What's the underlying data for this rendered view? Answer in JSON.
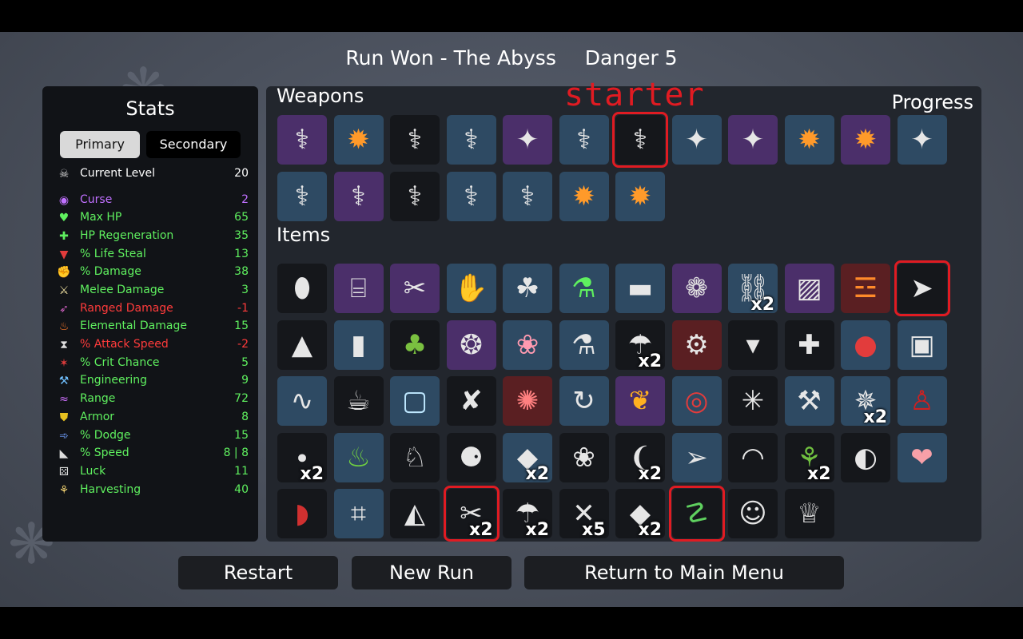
{
  "header": {
    "title": "Run Won - The Abyss",
    "danger": "Danger 5"
  },
  "stats": {
    "title": "Stats",
    "tabs": {
      "primary": "Primary",
      "secondary": "Secondary"
    },
    "rows": [
      {
        "icon": "skull-icon",
        "label": "Current Level",
        "value": "20",
        "label_color": "#ffffff",
        "value_color": "#ffffff"
      },
      {
        "icon": "eye-icon",
        "label": "Curse",
        "value": "2",
        "label_color": "#c070ff",
        "value_color": "#c070ff"
      },
      {
        "icon": "heart-icon",
        "label": "Max HP",
        "value": "65",
        "label_color": "#5ff05f",
        "value_color": "#5ff05f"
      },
      {
        "icon": "heart-plus-icon",
        "label": "HP Regeneration",
        "value": "35",
        "label_color": "#5ff05f",
        "value_color": "#5ff05f"
      },
      {
        "icon": "fang-icon",
        "label": "% Life Steal",
        "value": "13",
        "label_color": "#5ff05f",
        "value_color": "#5ff05f"
      },
      {
        "icon": "fist-icon",
        "label": "% Damage",
        "value": "38",
        "label_color": "#5ff05f",
        "value_color": "#5ff05f"
      },
      {
        "icon": "sword-icon",
        "label": "Melee Damage",
        "value": "3",
        "label_color": "#5ff05f",
        "value_color": "#5ff05f"
      },
      {
        "icon": "bow-icon",
        "label": "Ranged Damage",
        "value": "-1",
        "label_color": "#ff3b3b",
        "value_color": "#ff3b3b"
      },
      {
        "icon": "flame-icon",
        "label": "Elemental Damage",
        "value": "15",
        "label_color": "#5ff05f",
        "value_color": "#5ff05f"
      },
      {
        "icon": "hourglass-icon",
        "label": "% Attack Speed",
        "value": "-2",
        "label_color": "#ff3b3b",
        "value_color": "#ff3b3b"
      },
      {
        "icon": "crit-icon",
        "label": "% Crit Chance",
        "value": "5",
        "label_color": "#5ff05f",
        "value_color": "#5ff05f"
      },
      {
        "icon": "wrench-icon",
        "label": "Engineering",
        "value": "9",
        "label_color": "#5ff05f",
        "value_color": "#5ff05f"
      },
      {
        "icon": "range-icon",
        "label": "Range",
        "value": "72",
        "label_color": "#5ff05f",
        "value_color": "#5ff05f"
      },
      {
        "icon": "shield-icon",
        "label": "Armor",
        "value": "8",
        "label_color": "#5ff05f",
        "value_color": "#5ff05f"
      },
      {
        "icon": "dodge-icon",
        "label": "% Dodge",
        "value": "15",
        "label_color": "#5ff05f",
        "value_color": "#5ff05f"
      },
      {
        "icon": "boot-icon",
        "label": "% Speed",
        "value": "8 | 8",
        "label_color": "#5ff05f",
        "value_color": "#5ff05f"
      },
      {
        "icon": "dice-icon",
        "label": "Luck",
        "value": "11",
        "label_color": "#5ff05f",
        "value_color": "#5ff05f"
      },
      {
        "icon": "wheat-icon",
        "label": "Harvesting",
        "value": "40",
        "label_color": "#5ff05f",
        "value_color": "#5ff05f"
      }
    ]
  },
  "weapons": {
    "title": "Weapons",
    "starter_label": "starter",
    "progress_label": "Progress",
    "slots": [
      {
        "icon": "spoon-icon",
        "rarity": "purple"
      },
      {
        "icon": "fireball-icon",
        "rarity": "blue"
      },
      {
        "icon": "spoon-icon",
        "rarity": "black"
      },
      {
        "icon": "spoon-icon",
        "rarity": "blue"
      },
      {
        "icon": "wand-icon",
        "rarity": "purple"
      },
      {
        "icon": "spoon-icon",
        "rarity": "blue"
      },
      {
        "icon": "spoon-icon",
        "rarity": "black",
        "highlight": true
      },
      {
        "icon": "wand-icon",
        "rarity": "blue"
      },
      {
        "icon": "wand-icon",
        "rarity": "purple"
      },
      {
        "icon": "fireball-icon",
        "rarity": "blue"
      },
      {
        "icon": "fireball-icon",
        "rarity": "purple"
      },
      {
        "icon": "wand-icon",
        "rarity": "blue"
      },
      {
        "icon": "spoon-icon",
        "rarity": "blue"
      },
      {
        "icon": "spoon-icon",
        "rarity": "purple"
      },
      {
        "icon": "spoon-icon",
        "rarity": "black"
      },
      {
        "icon": "spoon-icon",
        "rarity": "blue"
      },
      {
        "icon": "spoon-icon",
        "rarity": "blue"
      },
      {
        "icon": "fireball-icon",
        "rarity": "blue"
      },
      {
        "icon": "fireball-icon",
        "rarity": "blue"
      }
    ]
  },
  "items": {
    "title": "Items",
    "slots": [
      {
        "icon": "egg-icon",
        "rarity": "black"
      },
      {
        "icon": "bottle-icon",
        "rarity": "purple"
      },
      {
        "icon": "pliers-icon",
        "rarity": "purple"
      },
      {
        "icon": "claw-glove-icon",
        "rarity": "blue"
      },
      {
        "icon": "garden-icon",
        "rarity": "blue"
      },
      {
        "icon": "potion-icon",
        "rarity": "blue"
      },
      {
        "icon": "rock-icon",
        "rarity": "blue"
      },
      {
        "icon": "tardigrade-icon",
        "rarity": "purple"
      },
      {
        "icon": "chain-icon",
        "rarity": "blue",
        "count": "x2"
      },
      {
        "icon": "mirror-icon",
        "rarity": "purple"
      },
      {
        "icon": "torch-icon",
        "rarity": "red"
      },
      {
        "icon": "drill-icon",
        "rarity": "black",
        "highlight": true
      },
      {
        "icon": "sack-icon",
        "rarity": "black"
      },
      {
        "icon": "stone-tablet-icon",
        "rarity": "blue"
      },
      {
        "icon": "tree-icon",
        "rarity": "black"
      },
      {
        "icon": "drone-icon",
        "rarity": "purple"
      },
      {
        "icon": "squid-icon",
        "rarity": "blue"
      },
      {
        "icon": "flask-icon",
        "rarity": "blue"
      },
      {
        "icon": "mushroom-icon",
        "rarity": "black",
        "count": "x2"
      },
      {
        "icon": "mech-icon",
        "rarity": "red"
      },
      {
        "icon": "tooth-icon",
        "rarity": "black"
      },
      {
        "icon": "medic-bot-icon",
        "rarity": "black"
      },
      {
        "icon": "tomato-icon",
        "rarity": "blue"
      },
      {
        "icon": "armor-plate-icon",
        "rarity": "blue"
      },
      {
        "icon": "worm-icon",
        "rarity": "blue"
      },
      {
        "icon": "tea-cup-icon",
        "rarity": "black"
      },
      {
        "icon": "ice-cube-icon",
        "rarity": "blue"
      },
      {
        "icon": "fish-head-icon",
        "rarity": "black"
      },
      {
        "icon": "octopus-icon",
        "rarity": "red"
      },
      {
        "icon": "tentacle-icon",
        "rarity": "blue"
      },
      {
        "icon": "goldfish-icon",
        "rarity": "purple"
      },
      {
        "icon": "lifebuoy-icon",
        "rarity": "blue"
      },
      {
        "icon": "hedgehog-icon",
        "rarity": "black"
      },
      {
        "icon": "wrench-arm-icon",
        "rarity": "blue"
      },
      {
        "icon": "wasp-icon",
        "rarity": "blue",
        "count": "x2"
      },
      {
        "icon": "ketchup-icon",
        "rarity": "blue"
      },
      {
        "icon": "pebbles-icon",
        "rarity": "black",
        "count": "x2"
      },
      {
        "icon": "cauldron-icon",
        "rarity": "blue"
      },
      {
        "icon": "dog-icon",
        "rarity": "black"
      },
      {
        "icon": "bat-icon",
        "rarity": "black"
      },
      {
        "icon": "grenade-icon",
        "rarity": "blue",
        "count": "x2"
      },
      {
        "icon": "spore-bag-icon",
        "rarity": "black"
      },
      {
        "icon": "leech-icon",
        "rarity": "black",
        "count": "x2"
      },
      {
        "icon": "missile-icon",
        "rarity": "blue"
      },
      {
        "icon": "beanie-icon",
        "rarity": "black"
      },
      {
        "icon": "sprout-icon",
        "rarity": "black",
        "count": "x2"
      },
      {
        "icon": "fang-mouth-icon",
        "rarity": "black"
      },
      {
        "icon": "piggy-bank-icon",
        "rarity": "blue"
      },
      {
        "icon": "whistle-icon",
        "rarity": "black"
      },
      {
        "icon": "cash-register-icon",
        "rarity": "blue"
      },
      {
        "icon": "cake-icon",
        "rarity": "black"
      },
      {
        "icon": "scar-icon",
        "rarity": "black",
        "count": "x2",
        "highlight": true
      },
      {
        "icon": "weird-mushroom-icon",
        "rarity": "black",
        "count": "x2"
      },
      {
        "icon": "thorn-icon",
        "rarity": "black",
        "count": "x5"
      },
      {
        "icon": "coal-icon",
        "rarity": "black",
        "count": "x2"
      },
      {
        "icon": "snake-icon",
        "rarity": "black",
        "highlight": true
      },
      {
        "icon": "owl-mask-icon",
        "rarity": "black"
      },
      {
        "icon": "penguin-icon",
        "rarity": "black"
      }
    ]
  },
  "buttons": {
    "restart": "Restart",
    "new_run": "New Run",
    "main_menu": "Return to Main Menu"
  }
}
